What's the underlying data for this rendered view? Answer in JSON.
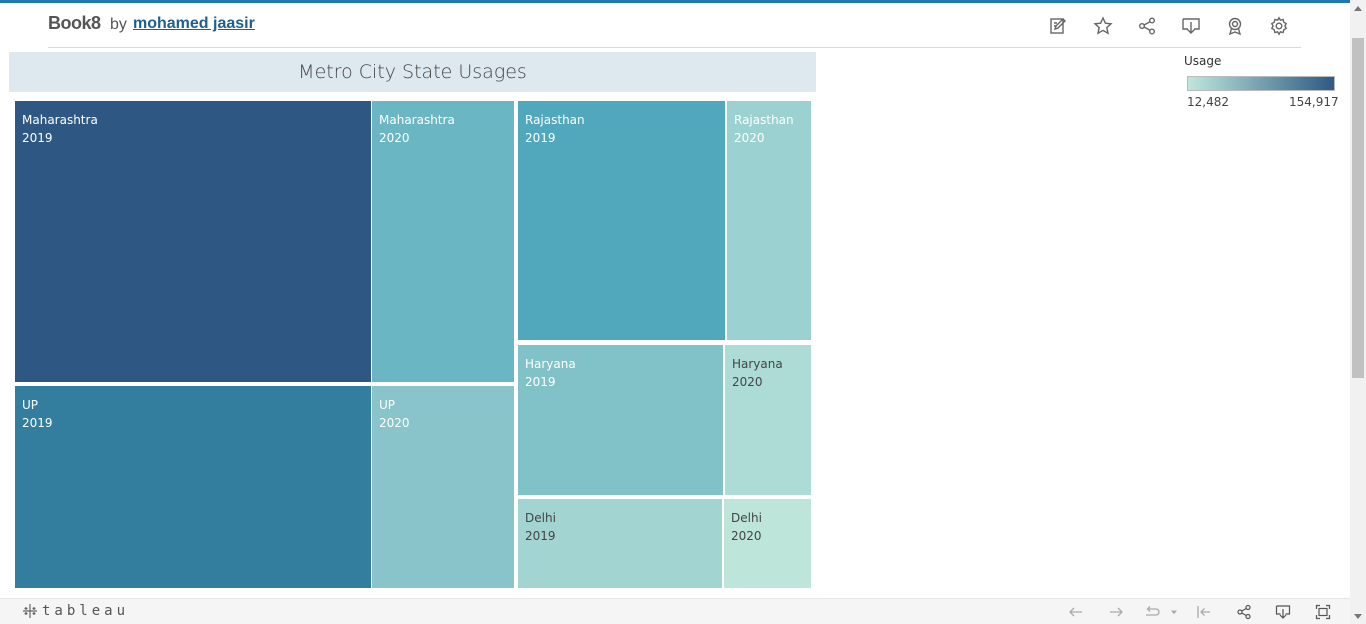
{
  "header": {
    "title": "Book8",
    "by": "by",
    "author": "mohamed jaasir",
    "icons": [
      "edit-icon",
      "star-icon",
      "share-icon",
      "download-icon",
      "badge-icon",
      "gear-icon"
    ]
  },
  "chart_data": {
    "type": "treemap",
    "title": "Metro City State Usages",
    "legend": {
      "title": "Usage",
      "min": "12,482",
      "max": "154,917",
      "min_color": "#bfe6dc",
      "max_color": "#2d5a84"
    },
    "tiles": [
      {
        "state": "Maharashtra",
        "year": "2019",
        "color": "#2e5883",
        "text_color": "#ffffff"
      },
      {
        "state": "Maharashtra",
        "year": "2020",
        "color": "#6bb6c3",
        "text_color": "#ffffff"
      },
      {
        "state": "UP",
        "year": "2019",
        "color": "#337d9f",
        "text_color": "#ffffff"
      },
      {
        "state": "UP",
        "year": "2020",
        "color": "#89c4cb",
        "text_color": "#ffffff"
      },
      {
        "state": "Rajasthan",
        "year": "2019",
        "color": "#51a8bc",
        "text_color": "#ffffff"
      },
      {
        "state": "Rajasthan",
        "year": "2020",
        "color": "#9bd1d0",
        "text_color": "#ffffff"
      },
      {
        "state": "Haryana",
        "year": "2019",
        "color": "#81c2c8",
        "text_color": "#ffffff"
      },
      {
        "state": "Haryana",
        "year": "2020",
        "color": "#addcd6",
        "text_color": "#444444"
      },
      {
        "state": "Delhi",
        "year": "2019",
        "color": "#a2d4d2",
        "text_color": "#444444"
      },
      {
        "state": "Delhi",
        "year": "2020",
        "color": "#bde5da",
        "text_color": "#444444"
      }
    ]
  },
  "footer": {
    "logo_text": "tableau",
    "icons": [
      "undo-icon",
      "redo-icon",
      "revert-icon",
      "dropdown-icon",
      "reset-icon",
      "share-icon",
      "download-icon",
      "fullscreen-icon"
    ]
  }
}
